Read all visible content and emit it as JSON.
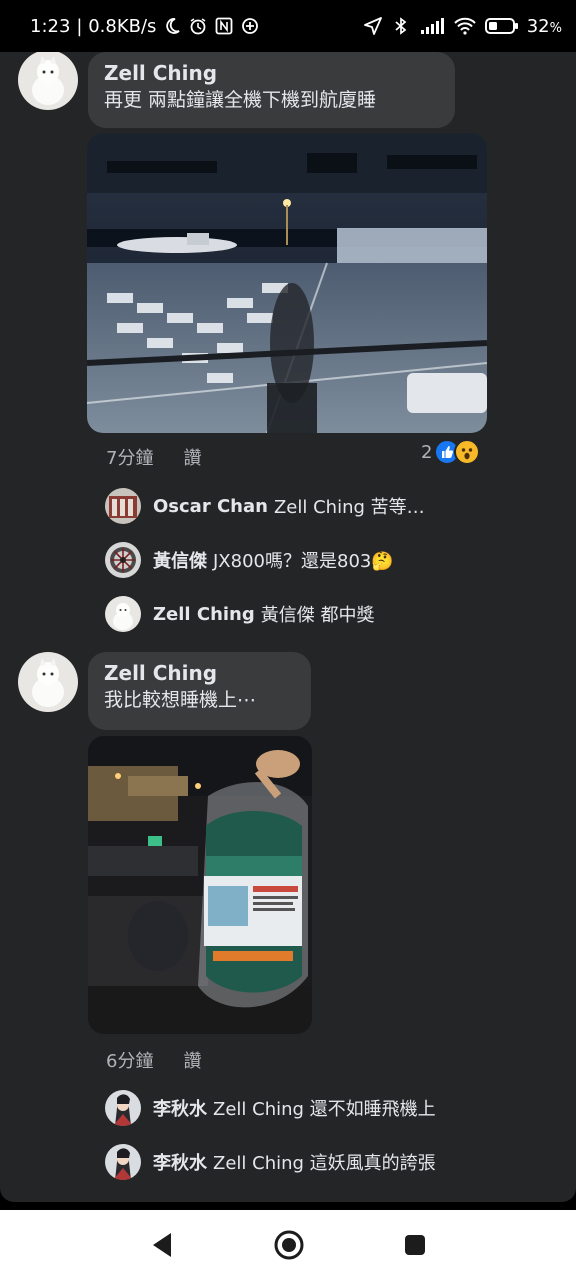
{
  "status_bar": {
    "time": "1:23",
    "net_speed": "| 0.8KB/s",
    "battery": "32",
    "battery_unit": "%"
  },
  "thread": [
    {
      "author": "Zell Ching",
      "text": "再更 兩點鐘讓全機下機到航廈睡",
      "photo_icon": "airport-night-photo",
      "time": "7分鐘",
      "like_label": "讚",
      "reaction_count": "2",
      "replies": [
        {
          "name": "Oscar Chan",
          "text": "Zell Ching 苦等…"
        },
        {
          "name": "黃信傑",
          "text": "JX800嗎？還是803🤔"
        },
        {
          "name": "Zell Ching",
          "text": "黃信傑 都中獎"
        }
      ]
    },
    {
      "author": "Zell Ching",
      "text": "我比較想睡機上⋯",
      "photo_icon": "sleeping-bag-photo",
      "time": "6分鐘",
      "like_label": "讚",
      "replies": [
        {
          "name": "李秋水",
          "text": "Zell Ching 還不如睡飛機上"
        },
        {
          "name": "李秋水",
          "text": "Zell Ching 這妖風真的誇張"
        }
      ]
    }
  ],
  "colors": {
    "panel_bg": "#242526",
    "bubble_bg": "#3a3b3c",
    "like_blue": "#1877f2",
    "wow_yellow": "#f7b928"
  }
}
